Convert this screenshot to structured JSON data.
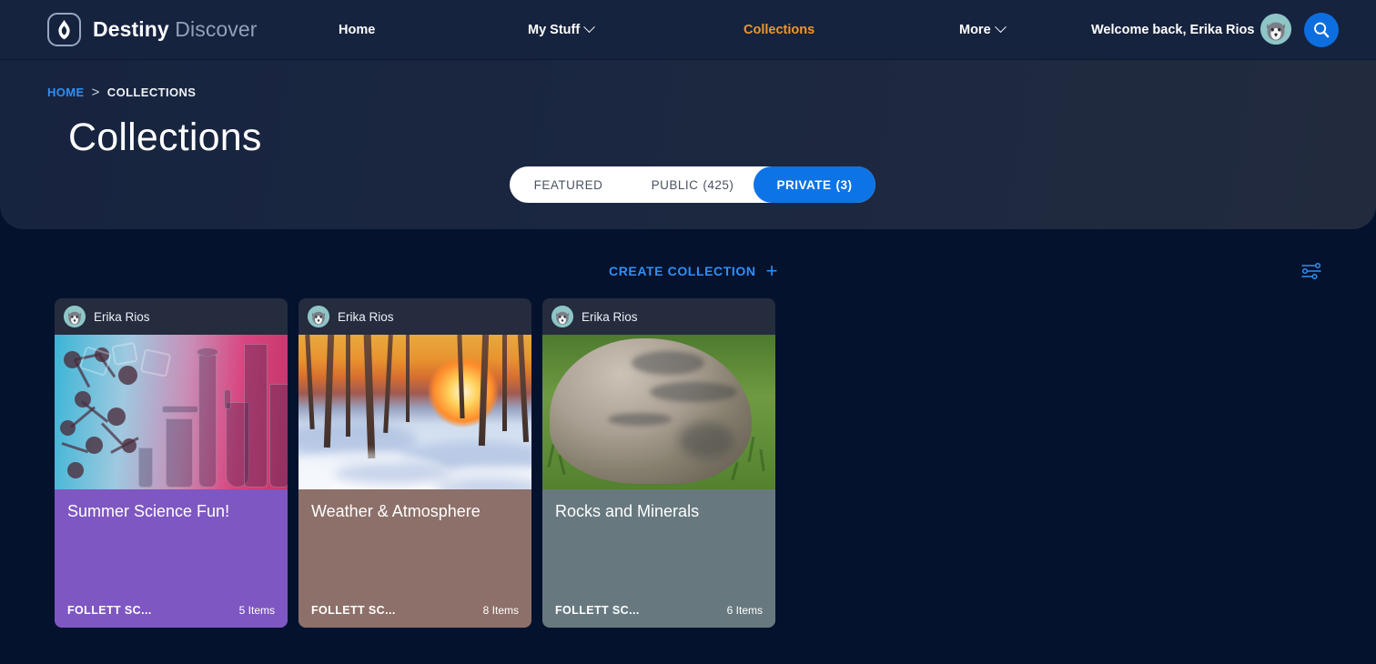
{
  "nav": {
    "logo_icon": "destiny-flame-logo-icon",
    "brand_primary": "Destiny",
    "brand_secondary": "Discover",
    "links": [
      {
        "label": "Home",
        "has_caret": false,
        "active": false
      },
      {
        "label": "My Stuff",
        "has_caret": true,
        "active": false
      },
      {
        "label": "Collections",
        "has_caret": false,
        "active": true
      },
      {
        "label": "More",
        "has_caret": true,
        "active": false
      }
    ],
    "welcome": "Welcome back, Erika Rios",
    "avatar_icon": "wolf-avatar-icon",
    "search_icon": "search-icon",
    "accent_active": "#f0952d",
    "search_button_color": "#0d6ee0"
  },
  "hero": {
    "breadcrumb": {
      "home": "HOME",
      "separator": ">",
      "current": "COLLECTIONS"
    },
    "title": "Collections",
    "tabs": [
      {
        "label": "FEATURED",
        "count": "",
        "active": false
      },
      {
        "label": "PUBLIC",
        "count": "(425)",
        "active": false
      },
      {
        "label": "PRIVATE",
        "count": "(3)",
        "active": true
      }
    ],
    "active_tab_color": "#0d74e7"
  },
  "main": {
    "create_label": "CREATE COLLECTION",
    "create_plus_icon": "plus-icon",
    "create_color": "#2f8ff5",
    "filter_icon": "filter-sliders-icon",
    "cards": [
      {
        "owner": "Erika Rios",
        "avatar_icon": "wolf-avatar-icon",
        "title": "Summer Science Fun!",
        "org": "FOLLETT SC...",
        "items": "5 Items",
        "footer_color": "#7e57c2",
        "image": "chemistry-lab-glassware-photo"
      },
      {
        "owner": "Erika Rios",
        "avatar_icon": "wolf-avatar-icon",
        "title": "Weather & Atmosphere",
        "org": "FOLLETT SC...",
        "items": "8 Items",
        "footer_color": "#8d7069",
        "image": "winter-sunset-birch-forest-photo"
      },
      {
        "owner": "Erika Rios",
        "avatar_icon": "wolf-avatar-icon",
        "title": "Rocks and Minerals",
        "org": "FOLLETT SC...",
        "items": "6 Items",
        "footer_color": "#67797f",
        "image": "granite-boulder-on-grass-photo"
      }
    ]
  }
}
